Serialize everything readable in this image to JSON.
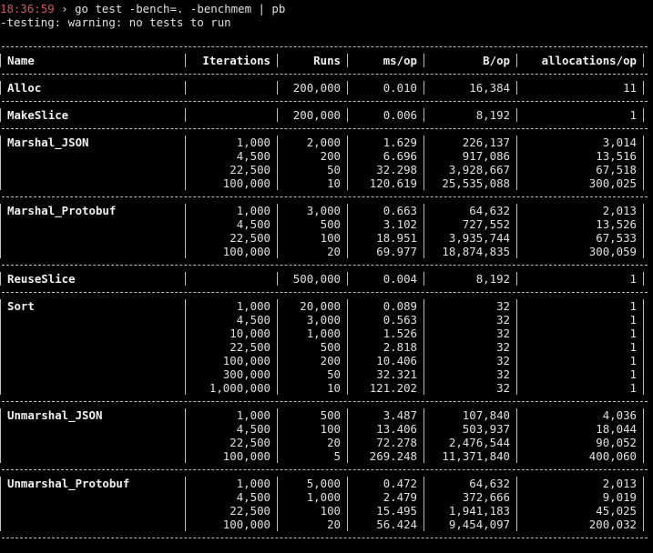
{
  "terminal": {
    "timestamp": "18:36:59",
    "prompt_sep": " › ",
    "command": "go test -bench=. -benchmem | pb",
    "warning": "-testing: warning: no tests to run"
  },
  "table": {
    "headers": [
      "Name",
      "Iterations",
      "Runs",
      "ms/op",
      "B/op",
      "allocations/op"
    ],
    "groups": [
      {
        "name": "Alloc",
        "rows": [
          {
            "iter": "",
            "runs": "200,000",
            "ms": "0.010",
            "b": "16,384",
            "alloc": "11"
          }
        ]
      },
      {
        "name": "MakeSlice",
        "rows": [
          {
            "iter": "",
            "runs": "200,000",
            "ms": "0.006",
            "b": "8,192",
            "alloc": "1"
          }
        ]
      },
      {
        "name": "Marshal_JSON",
        "rows": [
          {
            "iter": "1,000",
            "runs": "2,000",
            "ms": "1.629",
            "b": "226,137",
            "alloc": "3,014"
          },
          {
            "iter": "4,500",
            "runs": "200",
            "ms": "6.696",
            "b": "917,086",
            "alloc": "13,516"
          },
          {
            "iter": "22,500",
            "runs": "50",
            "ms": "32.298",
            "b": "3,928,667",
            "alloc": "67,518"
          },
          {
            "iter": "100,000",
            "runs": "10",
            "ms": "120.619",
            "b": "25,535,088",
            "alloc": "300,025"
          }
        ]
      },
      {
        "name": "Marshal_Protobuf",
        "rows": [
          {
            "iter": "1,000",
            "runs": "3,000",
            "ms": "0.663",
            "b": "64,632",
            "alloc": "2,013"
          },
          {
            "iter": "4,500",
            "runs": "500",
            "ms": "3.102",
            "b": "727,552",
            "alloc": "13,526"
          },
          {
            "iter": "22,500",
            "runs": "100",
            "ms": "18.951",
            "b": "3,935,744",
            "alloc": "67,533"
          },
          {
            "iter": "100,000",
            "runs": "20",
            "ms": "69.977",
            "b": "18,874,835",
            "alloc": "300,059"
          }
        ]
      },
      {
        "name": "ReuseSlice",
        "rows": [
          {
            "iter": "",
            "runs": "500,000",
            "ms": "0.004",
            "b": "8,192",
            "alloc": "1"
          }
        ]
      },
      {
        "name": "Sort",
        "rows": [
          {
            "iter": "1,000",
            "runs": "20,000",
            "ms": "0.089",
            "b": "32",
            "alloc": "1"
          },
          {
            "iter": "4,500",
            "runs": "3,000",
            "ms": "0.563",
            "b": "32",
            "alloc": "1"
          },
          {
            "iter": "10,000",
            "runs": "1,000",
            "ms": "1.526",
            "b": "32",
            "alloc": "1"
          },
          {
            "iter": "22,500",
            "runs": "500",
            "ms": "2.818",
            "b": "32",
            "alloc": "1"
          },
          {
            "iter": "100,000",
            "runs": "200",
            "ms": "10.406",
            "b": "32",
            "alloc": "1"
          },
          {
            "iter": "300,000",
            "runs": "50",
            "ms": "32.321",
            "b": "32",
            "alloc": "1"
          },
          {
            "iter": "1,000,000",
            "runs": "10",
            "ms": "121.202",
            "b": "32",
            "alloc": "1"
          }
        ]
      },
      {
        "name": "Unmarshal_JSON",
        "rows": [
          {
            "iter": "1,000",
            "runs": "500",
            "ms": "3.487",
            "b": "107,840",
            "alloc": "4,036"
          },
          {
            "iter": "4,500",
            "runs": "100",
            "ms": "13.406",
            "b": "503,937",
            "alloc": "18,044"
          },
          {
            "iter": "22,500",
            "runs": "20",
            "ms": "72.278",
            "b": "2,476,544",
            "alloc": "90,052"
          },
          {
            "iter": "100,000",
            "runs": "5",
            "ms": "269.248",
            "b": "11,371,840",
            "alloc": "400,060"
          }
        ]
      },
      {
        "name": "Unmarshal_Protobuf",
        "rows": [
          {
            "iter": "1,000",
            "runs": "5,000",
            "ms": "0.472",
            "b": "64,632",
            "alloc": "2,013"
          },
          {
            "iter": "4,500",
            "runs": "1,000",
            "ms": "2.479",
            "b": "372,666",
            "alloc": "9,019"
          },
          {
            "iter": "22,500",
            "runs": "100",
            "ms": "15.495",
            "b": "1,941,183",
            "alloc": "45,025"
          },
          {
            "iter": "100,000",
            "runs": "20",
            "ms": "56.424",
            "b": "9,454,097",
            "alloc": "200,032"
          }
        ]
      }
    ]
  },
  "colors": {
    "background": "#000000",
    "text": "#e0e0e0",
    "timestamp": "#d25a5a",
    "border": "#bdbdbd"
  }
}
